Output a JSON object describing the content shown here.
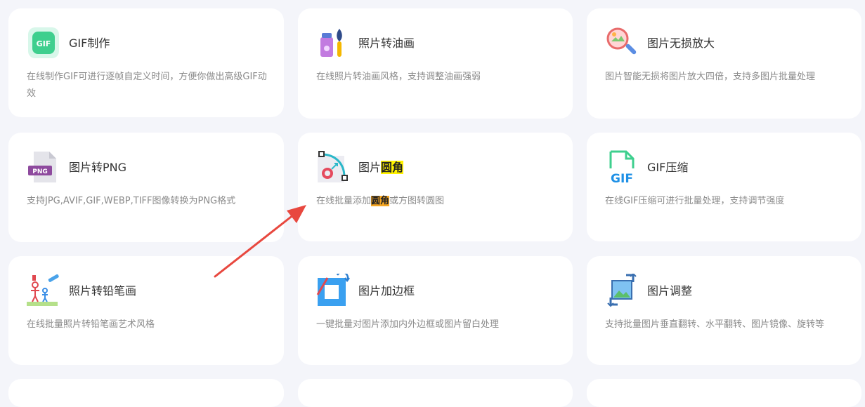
{
  "cards": [
    {
      "title": "GIF制作",
      "desc": "在线制作GIF可进行逐帧自定义时间，方便你做出高级GIF动效",
      "icon": "gif-maker-icon"
    },
    {
      "title": "照片转油画",
      "desc": "在线照片转油画风格，支持调整油画强弱",
      "icon": "paint-brush-icon"
    },
    {
      "title": "图片无损放大",
      "desc": "图片智能无损将图片放大四倍，支持多图片批量处理",
      "icon": "magnifier-icon"
    },
    {
      "title": "图片转PNG",
      "desc": "支持JPG,AVIF,GIF,WEBP,TIFF图像转换为PNG格式",
      "icon": "png-file-icon",
      "icon_text": "PNG"
    },
    {
      "title_prefix": "图片",
      "title_highlight": "圆角",
      "desc_prefix": "在线批量添加",
      "desc_highlight": "圆角",
      "desc_suffix": "或方图转圆图",
      "icon": "rounded-corner-icon"
    },
    {
      "title": "GIF压缩",
      "desc": "在线GIF压缩可进行批量处理，支持调节强度",
      "icon": "gif-compress-icon",
      "icon_text": "GIF"
    },
    {
      "title": "照片转铅笔画",
      "desc": "在线批量照片转铅笔画艺术风格",
      "icon": "pencil-drawing-icon"
    },
    {
      "title": "图片加边框",
      "desc": "一键批量对图片添加内外边框或图片留白处理",
      "icon": "image-border-icon"
    },
    {
      "title": "图片调整",
      "desc": "支持批量图片垂直翻转、水平翻转、图片镜像、旋转等",
      "icon": "image-adjust-icon"
    }
  ],
  "colors": {
    "background": "#f4f5fa",
    "card": "#ffffff",
    "arrow": "#e8483f",
    "highlight_title": "#fff200",
    "highlight_desc": "#f5a623"
  }
}
